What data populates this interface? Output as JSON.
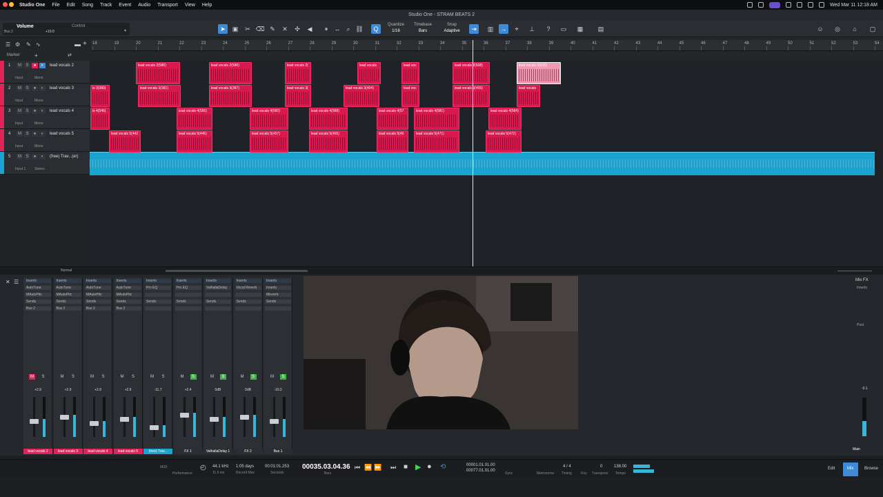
{
  "menubar": {
    "app": "Studio One",
    "items": [
      "File",
      "Edit",
      "Song",
      "Track",
      "Event",
      "Audio",
      "Transport",
      "View",
      "Help"
    ],
    "clock": "Wed Mar 11  12:18 AM"
  },
  "window": {
    "title": "Studio One - STRAM BEATS 2"
  },
  "toolbar": {
    "param_name": "Volume",
    "param_track": "Bus 2",
    "param_value": "+10.0",
    "control_label": "Control",
    "quantize_label": "Quantize",
    "quantize_value": "1/16",
    "timebase_label": "Timebase",
    "timebase_value": "Bars",
    "snap_label": "Snap",
    "snap_value": "Adaptive"
  },
  "marker_label": "Marker",
  "ruler": {
    "bars": [
      "18",
      "19",
      "20",
      "21",
      "22",
      "23",
      "24",
      "25",
      "26",
      "27",
      "28",
      "29",
      "30",
      "31",
      "32",
      "33",
      "34",
      "35",
      "36",
      "37",
      "38",
      "39",
      "40",
      "41",
      "42",
      "43",
      "44",
      "45",
      "46",
      "47",
      "48",
      "49",
      "50",
      "51",
      "52",
      "53",
      "54"
    ]
  },
  "tracks": [
    {
      "num": "1",
      "name": "lead vocals 2",
      "input": "Input",
      "mode": "Mono",
      "color": "#e0245a"
    },
    {
      "num": "2",
      "name": "lead vocals 3",
      "input": "Input",
      "mode": "Mono",
      "color": "#e0245a"
    },
    {
      "num": "3",
      "name": "lead vocals 4",
      "input": "Input",
      "mode": "Mono",
      "color": "#e0245a"
    },
    {
      "num": "4",
      "name": "lead vocals 5",
      "input": "Input",
      "mode": "Mono",
      "color": "#e0245a"
    },
    {
      "num": "5",
      "name": "(free) Trav...(er)",
      "input": "Input 1",
      "mode": "Stereo",
      "color": "#1aa3cf"
    }
  ],
  "clips": {
    "row1": [
      {
        "label": "lead vocals 2(586)"
      },
      {
        "label": "lead vocals 2(590)"
      },
      {
        "label": "lead vocals 2("
      },
      {
        "label": "lead vocals"
      },
      {
        "label": "lead voc"
      },
      {
        "label": "lead vocals 2(608)"
      },
      {
        "label": "lead vocals 2(615)"
      }
    ],
    "row2": [
      {
        "label": "ls 3(380)"
      },
      {
        "label": "lead vocals 3(381)"
      },
      {
        "label": "lead vocals 3(387)"
      },
      {
        "label": "lead vocals 3("
      },
      {
        "label": "lead vocals 3(404)"
      },
      {
        "label": "lead voc"
      },
      {
        "label": "lead vocals 3(409)"
      },
      {
        "label": "lead vocals"
      }
    ],
    "row3": [
      {
        "label": "ls 4(546)"
      },
      {
        "label": "lead vocals 4(556)"
      },
      {
        "label": "lead vocals 4(560)"
      },
      {
        "label": "lead vocals 4(568)"
      },
      {
        "label": "lead vocals 4(57"
      },
      {
        "label": "lead vocals 4(581)"
      },
      {
        "label": "lead vocals 4(584)"
      }
    ],
    "row4": [
      {
        "label": "lead vocals 5(442"
      },
      {
        "label": "lead vocals 5(445)"
      },
      {
        "label": "lead vocals 5(457)"
      },
      {
        "label": "lead vocals 5(465)"
      },
      {
        "label": "lead vocals 5(46"
      },
      {
        "label": "lead vocals 5(471)"
      },
      {
        "label": "lead vocals 5(472)"
      }
    ]
  },
  "scroll_mode": "Normal",
  "mixer": {
    "channels": [
      {
        "name": "lead vocals 2",
        "vol": "+2.9",
        "insert1": "AutoTune",
        "insert2": "MAutoPitc",
        "send": "Bus 2",
        "num": "1",
        "color": "#e0245a",
        "level": 0.45
      },
      {
        "name": "lead vocals 3",
        "vol": "+2.9",
        "insert1": "AutoTune",
        "insert2": "MAutoPitc",
        "send": "Bus 2",
        "num": "2",
        "color": "#e0245a",
        "level": 0.55
      },
      {
        "name": "lead vocals 4",
        "vol": "+2.9",
        "insert1": "AutoTune",
        "insert2": "MAutoPitc",
        "send": "Bus 2",
        "num": "3",
        "color": "#e0245a",
        "level": 0.4
      },
      {
        "name": "lead vocals 5",
        "vol": "+2.9",
        "insert1": "AutoTune",
        "insert2": "MAutoPitc",
        "send": "Bus 2",
        "num": "4",
        "color": "#e0245a",
        "level": 0.5
      },
      {
        "name": "(free) Trav...",
        "vol": "-11.7",
        "insert1": "Pro EQ",
        "insert2": "",
        "send": "",
        "num": "5",
        "color": "#1aa3cf",
        "level": 0.3
      },
      {
        "name": "FX 1",
        "vol": "+2.4",
        "insert1": "Pro EQ",
        "insert2": "",
        "send": "",
        "num": "6",
        "color": "#2a2d31",
        "level": 0.6
      },
      {
        "name": "ValhallaDelay 1",
        "vol": "0dB",
        "insert1": "ValhallaDelay",
        "insert2": "",
        "send": "",
        "num": "7",
        "color": "#2a2d31",
        "level": 0.5
      },
      {
        "name": "FX 2",
        "vol": "0dB",
        "insert1": "Vocal Reverb",
        "insert2": "",
        "send": "",
        "num": "8",
        "color": "#2a2d31",
        "level": 0.55
      },
      {
        "name": "Bus 1",
        "vol": "-10.2",
        "insert1": "Inserts",
        "insert2": "Mixverb",
        "send": "",
        "num": "9",
        "color": "#2a2d31",
        "level": 0.45
      }
    ],
    "inserts_label": "Inserts",
    "sends_label": "Sends",
    "mixfx_label": "Mix FX",
    "main_label": "Main",
    "main_vol": "-0.1",
    "post_label": "Post"
  },
  "transport": {
    "sample_rate": "44.1 kHz",
    "latency": "11.6 ms",
    "record_max": "1:05 days",
    "record_max_label": "Record Max",
    "time_seconds": "00:01:01.253",
    "seconds_label": "Seconds",
    "position": "00035.03.04.36",
    "bars_label": "Bars",
    "loop_start": "00001.01.01.00",
    "loop_end": "00077.01.01.00",
    "sync_label": "Sync",
    "metronome_label": "Metronome",
    "timing": "4 / 4",
    "timing_label": "Timing",
    "key_label": "Key",
    "transpose": "0",
    "transpose_label": "Transpose",
    "tempo": "138.00",
    "tempo_label": "Tempo",
    "midi_label": "MIDI",
    "performance_label": "Performance",
    "edit_tab": "Edit",
    "mix_tab": "Mix",
    "browse_tab": "Browse"
  }
}
